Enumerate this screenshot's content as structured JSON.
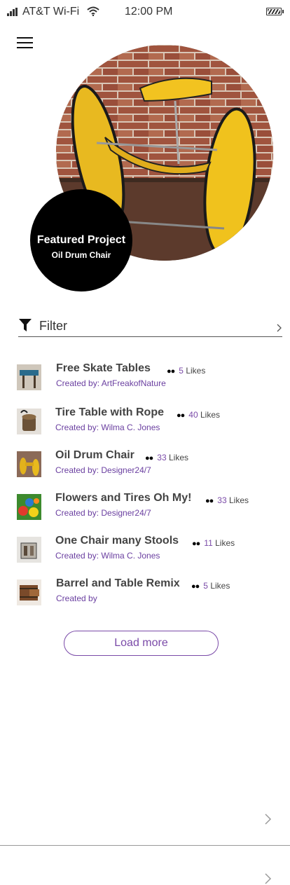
{
  "status_bar": {
    "carrier": "AT&T Wi-Fi",
    "time": "12:00 PM",
    "icons": [
      "signal-icon",
      "wifi-icon",
      "battery-icon"
    ]
  },
  "header": {
    "menu_icon": "hamburger-menu-icon"
  },
  "featured": {
    "title": "Featured Project",
    "subtitle": "Oil Drum Chair"
  },
  "filter": {
    "label": "Filter",
    "icon": "funnel-icon"
  },
  "projects": [
    {
      "title": "Free Skate Tables",
      "likes": "5",
      "likes_label": "Likes",
      "creator": "Created by: ArtFreakofNature",
      "thumb": "skate-table-thumbnail"
    },
    {
      "title": "Tire Table with Rope",
      "likes": "40",
      "likes_label": "Likes",
      "creator": "Created by: Wilma C. Jones",
      "thumb": "tire-table-thumbnail"
    },
    {
      "title": "Oil Drum Chair",
      "likes": "33",
      "likes_label": "Likes",
      "creator": "Created by: Designer24/7",
      "thumb": "oil-drum-chair-thumbnail"
    },
    {
      "title": "Flowers and Tires Oh My!",
      "likes": "33",
      "likes_label": "Likes",
      "creator": "Created by: Designer24/7",
      "thumb": "flower-tires-thumbnail"
    },
    {
      "title": "One Chair many Stools",
      "likes": "11",
      "likes_label": "Likes",
      "creator": "Created by: Wilma C. Jones",
      "thumb": "stools-thumbnail"
    },
    {
      "title": "Barrel and Table Remix",
      "likes": "5",
      "likes_label": "Likes",
      "creator": "Created by",
      "thumb": "barrel-table-thumbnail"
    }
  ],
  "load_more": "Load more",
  "colors": {
    "accent": "#7a4aa8",
    "badge": "#000000",
    "text": "#333333"
  }
}
